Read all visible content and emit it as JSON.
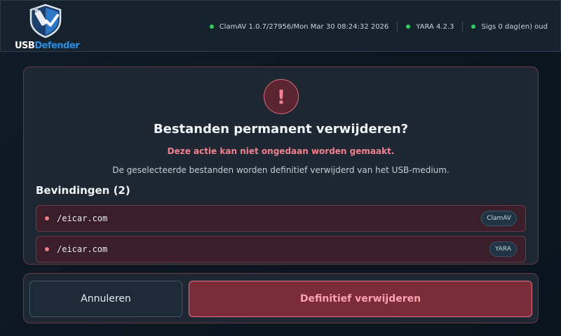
{
  "app": {
    "logo_text_a": "USB",
    "logo_text_b": "Defender"
  },
  "status": [
    {
      "text": "ClamAV 1.0.7/27956/Mon Mar 30 08:24:32 2026"
    },
    {
      "text": "YARA 4.2.3"
    },
    {
      "text": "Sigs 0 dag(en) oud"
    }
  ],
  "colors": {
    "status_ok": "#2ecc55",
    "danger": "#e06d7b",
    "accent": "#2c8de0"
  },
  "dialog": {
    "icon": "exclamation-icon",
    "icon_glyph": "!",
    "title": "Bestanden permanent verwijderen?",
    "warning": "Deze actie kan niet ongedaan worden gemaakt.",
    "description": "De geselecteerde bestanden worden definitief verwijderd van het USB-medium.",
    "findings_heading": "Bevindingen (2)",
    "findings": [
      {
        "path": "/eicar.com",
        "engine": "ClamAV"
      },
      {
        "path": "/eicar.com",
        "engine": "YARA"
      }
    ]
  },
  "actions": {
    "cancel_label": "Annuleren",
    "delete_label": "Definitief verwijderen"
  }
}
